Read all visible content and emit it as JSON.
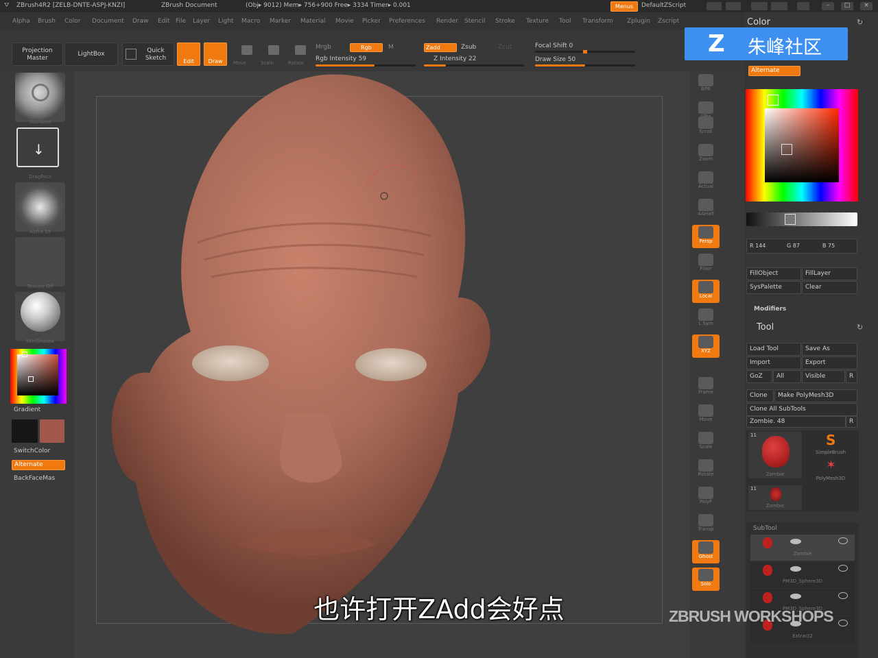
{
  "titlebar": {
    "app": "ZBrush4R2 [ZELB-DNTE-ASPJ-KNZI]",
    "document": "ZBrush Document",
    "stats": "(Obj▸ 9012) Mem▸ 756+900  Free▸ 3334  Timer▸ 0.001",
    "menus_button": "Menus",
    "script": "DefaultZScript"
  },
  "menubar": [
    "Alpha",
    "Brush",
    "Color",
    "Document",
    "Draw",
    "Edit",
    "File",
    "Layer",
    "Light",
    "Macro",
    "Marker",
    "Material",
    "Movie",
    "Picker",
    "Preferences",
    "Render",
    "Stencil",
    "Stroke",
    "Texture",
    "Tool",
    "Transform",
    "Zplugin",
    "Zscript"
  ],
  "shelf": {
    "projection_master": "Projection Master",
    "lightbox": "LightBox",
    "quick_sketch": "Quick Sketch",
    "edit": "Edit",
    "draw": "Draw",
    "move": "Move",
    "scale": "Scale",
    "rotate": "Rotate",
    "mrgb": "Mrgb",
    "rgb": "Rgb",
    "m": "M",
    "rgb_intensity": "Rgb Intensity 59",
    "zadd": "Zadd",
    "zsub": "Zsub",
    "zcut": "Zcut",
    "z_intensity": "Z Intensity 22",
    "focal_shift": "Focal Shift 0",
    "draw_size": "Draw Size 50"
  },
  "levels": {
    "rgb_intensity": 0.59,
    "z_intensity": 0.22,
    "draw_size": 0.5
  },
  "leftshelf": {
    "brush": "Standard",
    "stroke": "DragRect",
    "alpha": "Alpha 19",
    "texture": "Texture Off",
    "material": "SkinShade4",
    "gradient": "Gradient",
    "switchcolor": "SwitchColor",
    "alternate": "Alternate",
    "backface": "BackFaceMas"
  },
  "rightshelf": [
    "BPR",
    "SPix",
    "Scroll",
    "Zoom",
    "Actual",
    "AAHalf",
    "Persp",
    "Floor",
    "Local",
    "L.Sym",
    "XYZ",
    "Frame",
    "Move",
    "Scale",
    "Rotate",
    "PolyF",
    "Transp",
    "Ghost",
    "Solo"
  ],
  "color_panel": {
    "title": "Color",
    "alternate": "Alternate",
    "r": "R 144",
    "g": "G 87",
    "b": "B 75",
    "fillobject": "FillObject",
    "filllayer": "FillLayer",
    "syspalette": "SysPalette",
    "clear": "Clear",
    "modifiers": "Modifiers"
  },
  "tool_panel": {
    "title": "Tool",
    "load_tool": "Load Tool",
    "save_as": "Save As",
    "import": "Import",
    "export": "Export",
    "goz": "GoZ",
    "all": "All",
    "visible": "Visible",
    "r": "R",
    "clone": "Clone",
    "make_polymesh": "Make PolyMesh3D",
    "clone_all": "Clone All SubTools",
    "current_tool": "Zombie. 48",
    "tool_r": "R",
    "thumb1_label": "Zombie",
    "thumb1_count": "11",
    "thumb2_label": "SimpleBrush",
    "thumb3_label": "PolyMesh3D",
    "thumb4_label": "Zombie",
    "thumb4_count": "11"
  },
  "subtool_panel": {
    "title": "SubTool",
    "items": [
      "Zombie",
      "PM3D_Sphere3D",
      "PM3D_Sphere3D",
      "Extract2"
    ]
  },
  "logo_text": "朱峰社区",
  "subtitle": "也许打开ZAdd会好点",
  "watermark": "ZBRUSH WORKSHOPS",
  "colors": {
    "accent": "#f07a10",
    "skin": "#a86a58",
    "main_color": "#90574b",
    "logo_blue": "#3d8ff0"
  }
}
